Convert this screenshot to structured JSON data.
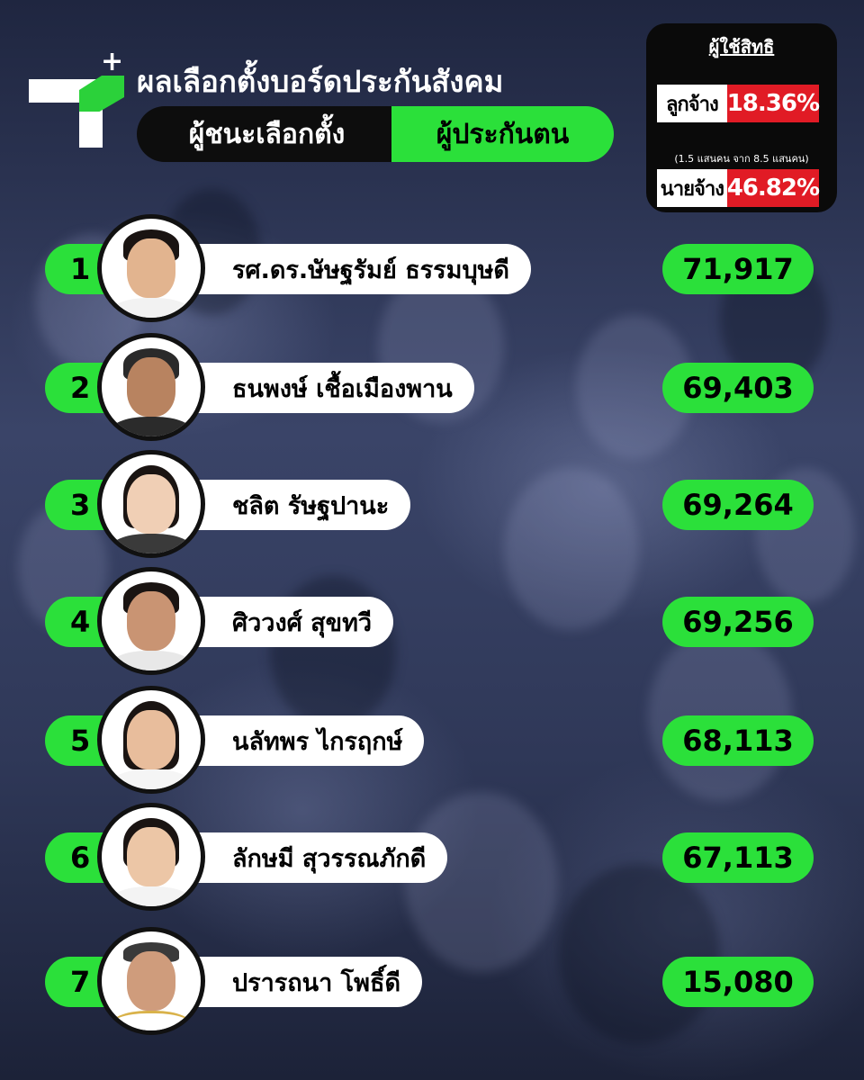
{
  "header": {
    "title": "ผลเลือกตั้งบอร์ดประกันสังคม",
    "tag_left": "ผู้ชนะเลือกตั้ง",
    "tag_right": "ผู้ประกันตน"
  },
  "turnout": {
    "heading": "ผู้ใช้สิทธิ",
    "employee_label": "ลูกจ้าง",
    "employee_value": "18.36%",
    "employee_note": "(1.5 แสนคน จาก 8.5 แสนคน)",
    "employer_label": "นายจ้าง",
    "employer_value": "46.82%",
    "colors": {
      "accent": "#e11b25",
      "bg": "#0a0a0a"
    }
  },
  "results": [
    {
      "rank": "1",
      "name": "รศ.ดร.ษัษฐรัมย์ ธรรมบุษดี",
      "votes": "71,917"
    },
    {
      "rank": "2",
      "name": "ธนพงษ์ เชื้อเมืองพาน",
      "votes": "69,403"
    },
    {
      "rank": "3",
      "name": "ชลิต รัษฐปานะ",
      "votes": "69,264"
    },
    {
      "rank": "4",
      "name": "ศิววงศ์ สุขทวี",
      "votes": "69,256"
    },
    {
      "rank": "5",
      "name": "นลัทพร ไกรฤกษ์",
      "votes": "68,113"
    },
    {
      "rank": "6",
      "name": "ลักษมี สุวรรณภักดี",
      "votes": "67,113"
    },
    {
      "rank": "7",
      "name": "ปรารถนา โพธิ์ดี",
      "votes": "15,080"
    }
  ],
  "colors": {
    "green": "#2be03a",
    "brand_green": "#2bd13a",
    "background": "#2a3354"
  }
}
